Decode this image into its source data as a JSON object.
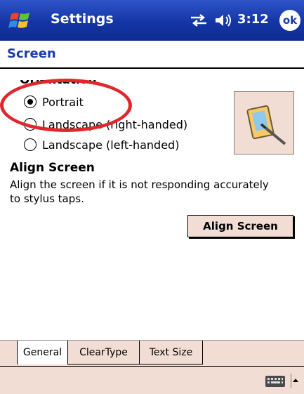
{
  "titlebar": {
    "title": "Settings",
    "time": "3:12",
    "ok_label": "ok"
  },
  "page": {
    "title": "Screen"
  },
  "orientation": {
    "heading": "Orientation",
    "options": [
      {
        "label": "Portrait",
        "checked": true
      },
      {
        "label": "Landscape (right-handed)",
        "checked": false
      },
      {
        "label": "Landscape (left-handed)",
        "checked": false
      }
    ]
  },
  "align": {
    "heading": "Align Screen",
    "description": "Align the screen if it is not responding accurately to stylus taps.",
    "button_label": "Align Screen"
  },
  "tabs": [
    {
      "label": "General",
      "active": true
    },
    {
      "label": "ClearType",
      "active": false
    },
    {
      "label": "Text Size",
      "active": false
    }
  ],
  "icons": {
    "start": "windows-flag-icon",
    "connectivity": "connectivity-arrows-icon",
    "volume": "speaker-icon",
    "preview": "pda-stylus-icon",
    "keyboard": "keyboard-icon",
    "sip_menu": "up-arrow-icon"
  },
  "colors": {
    "titlebar": "#1435a6",
    "accent_text": "#1c3ca8",
    "annotation": "#e0282c",
    "panel": "#f2ddd4"
  }
}
